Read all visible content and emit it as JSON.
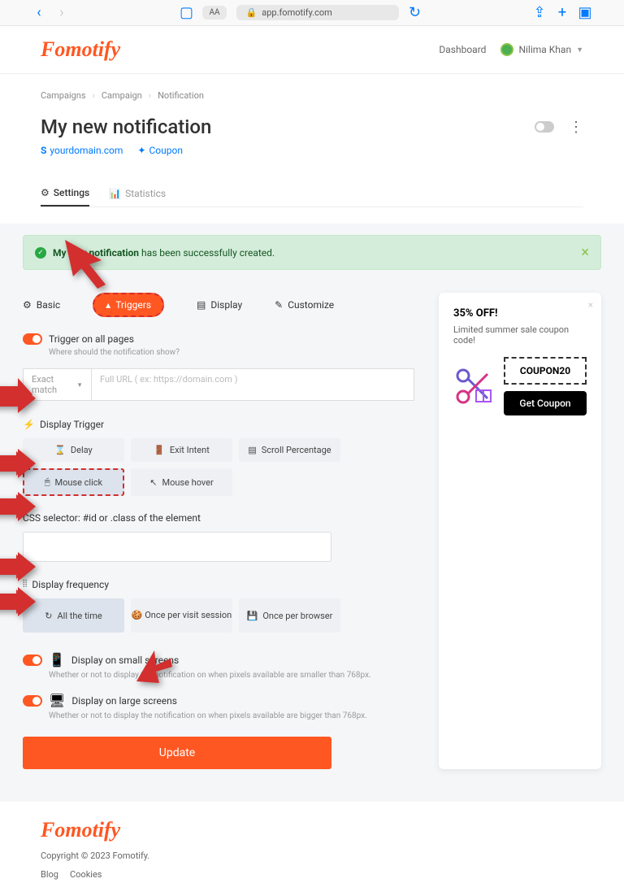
{
  "browser": {
    "url": "app.fomotify.com",
    "aa": "AA"
  },
  "header": {
    "logo": "Fomotify",
    "dashboard": "Dashboard",
    "user": "Nilima Khan"
  },
  "breadcrumb": [
    "Campaigns",
    "Campaign",
    "Notification"
  ],
  "page": {
    "title": "My new notification",
    "domain": "yourdomain.com",
    "type": "Coupon"
  },
  "tabs": {
    "settings": "Settings",
    "statistics": "Statistics"
  },
  "alert": {
    "prefix": "My new notification",
    "suffix": " has been successfully created."
  },
  "sectionTabs": {
    "basic": "Basic",
    "triggers": "Triggers",
    "display": "Display",
    "customize": "Customize"
  },
  "triggers": {
    "allPages": "Trigger on all pages",
    "allPagesHint": "Where should the notification show?",
    "matchSelect": "Exact match",
    "urlPlaceholder": "Full URL ( ex: https://domain.com )",
    "displayTrigger": "Display Trigger",
    "delay": "Delay",
    "exitIntent": "Exit Intent",
    "scrollPct": "Scroll Percentage",
    "mouseClick": "Mouse click",
    "mouseHover": "Mouse hover",
    "cssSelector": "CSS selector: #id or .class of the element",
    "displayFreq": "Display frequency",
    "allTime": "All the time",
    "perSession": "Once per visit session",
    "perBrowser": "Once per browser",
    "smallScreens": "Display on small screens",
    "smallHint": "Whether or not to display the notification on when pixels available are smaller than 768px.",
    "largeScreens": "Display on large screens",
    "largeHint": "Whether or not to display the notification on when pixels available are bigger than 768px.",
    "update": "Update"
  },
  "preview": {
    "title": "35% OFF!",
    "desc": "Limited summer sale coupon code!",
    "code": "COUPON20",
    "cta": "Get Coupon"
  },
  "footer": {
    "logo": "Fomotify",
    "copy": "Copyright © 2023 Fomotify.",
    "blog": "Blog",
    "cookies": "Cookies"
  }
}
